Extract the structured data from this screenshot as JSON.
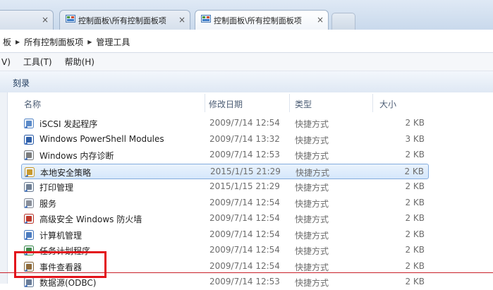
{
  "tabs": [
    {
      "label": "控制面板\\所有控制面板项",
      "active": false
    },
    {
      "label": "控制面板\\所有控制面板项",
      "active": true
    }
  ],
  "breadcrumb": [
    "板",
    "所有控制面板项",
    "管理工具"
  ],
  "menu": [
    "V)",
    "工具(T)",
    "帮助(H)"
  ],
  "command": {
    "burn": "刻录"
  },
  "columns": {
    "name": "名称",
    "date": "修改日期",
    "type": "类型",
    "size": "大小"
  },
  "rows": [
    {
      "name": "iSCSI 发起程序",
      "date": "2009/7/14 12:54",
      "type": "快捷方式",
      "size": "2 KB",
      "icon": "iscsi-icon"
    },
    {
      "name": "Windows PowerShell Modules",
      "date": "2009/7/14 13:32",
      "type": "快捷方式",
      "size": "3 KB",
      "icon": "powershell-icon"
    },
    {
      "name": "Windows 内存诊断",
      "date": "2009/7/14 12:53",
      "type": "快捷方式",
      "size": "2 KB",
      "icon": "memory-diagnostic-icon"
    },
    {
      "name": "本地安全策略",
      "date": "2015/1/15 21:29",
      "type": "快捷方式",
      "size": "2 KB",
      "icon": "security-policy-icon"
    },
    {
      "name": "打印管理",
      "date": "2015/1/15 21:29",
      "type": "快捷方式",
      "size": "2 KB",
      "icon": "printer-icon"
    },
    {
      "name": "服务",
      "date": "2009/7/14 12:54",
      "type": "快捷方式",
      "size": "2 KB",
      "icon": "services-icon"
    },
    {
      "name": "高级安全 Windows 防火墙",
      "date": "2009/7/14 12:54",
      "type": "快捷方式",
      "size": "2 KB",
      "icon": "firewall-icon"
    },
    {
      "name": "计算机管理",
      "date": "2009/7/14 12:54",
      "type": "快捷方式",
      "size": "2 KB",
      "icon": "computer-management-icon"
    },
    {
      "name": "任务计划程序",
      "date": "2009/7/14 12:54",
      "type": "快捷方式",
      "size": "2 KB",
      "icon": "task-scheduler-icon"
    },
    {
      "name": "事件查看器",
      "date": "2009/7/14 12:54",
      "type": "快捷方式",
      "size": "2 KB",
      "icon": "event-viewer-icon"
    },
    {
      "name": "数据源(ODBC)",
      "date": "2009/7/14 12:53",
      "type": "快捷方式",
      "size": "2 KB",
      "icon": "odbc-icon"
    }
  ],
  "selected_index": 3,
  "colors": {
    "highlight_box": "#e3141b",
    "selection": "#d5e7fb"
  }
}
